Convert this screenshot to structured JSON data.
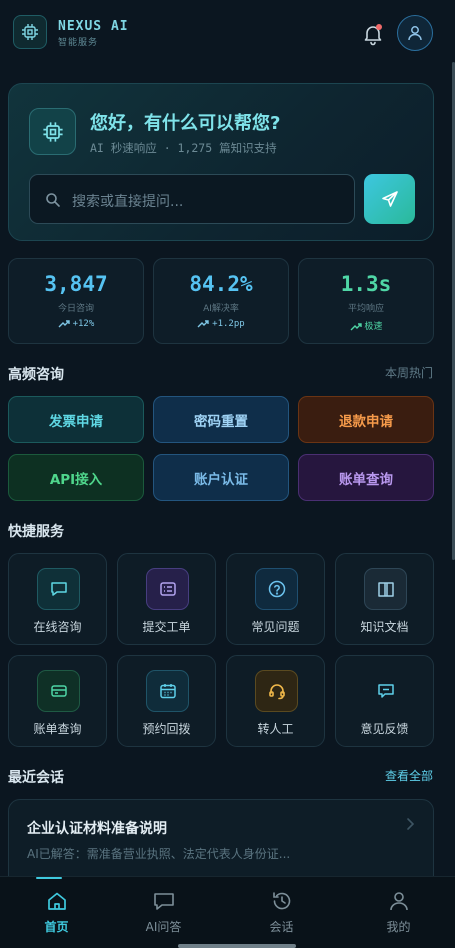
{
  "brand": {
    "name": "NEXUS AI",
    "subtitle": "智能服务"
  },
  "hero": {
    "title": "您好，有什么可以帮您?",
    "subtitle": "AI 秒速响应 · 1,275 篇知识支持",
    "search_placeholder": "搜索或直接提问..."
  },
  "stats": [
    {
      "value": "3,847",
      "label": "今日咨询",
      "trend": "+12%",
      "color": "#56c3f2"
    },
    {
      "value": "84.2%",
      "label": "AI解决率",
      "trend": "+1.2pp",
      "color": "#56c3f2"
    },
    {
      "value": "1.3s",
      "label": "平均响应",
      "trend": "极速",
      "color": "#4fd6a6"
    }
  ],
  "hot": {
    "title": "高频咨询",
    "more": "本周热门",
    "items": [
      "发票申请",
      "密码重置",
      "退款申请",
      "API接入",
      "账户认证",
      "账单查询"
    ]
  },
  "quick": {
    "title": "快捷服务",
    "items": [
      {
        "label": "在线咨询",
        "icon": "chat-bubble-icon"
      },
      {
        "label": "提交工单",
        "icon": "ticket-icon"
      },
      {
        "label": "常见问题",
        "icon": "help-circle-icon"
      },
      {
        "label": "知识文档",
        "icon": "book-icon"
      },
      {
        "label": "账单查询",
        "icon": "credit-card-icon"
      },
      {
        "label": "预约回拨",
        "icon": "calendar-icon"
      },
      {
        "label": "转人工",
        "icon": "headset-icon"
      },
      {
        "label": "意见反馈",
        "icon": "feedback-icon"
      }
    ]
  },
  "recent": {
    "title": "最近会话",
    "more": "查看全部",
    "items": [
      {
        "title": "企业认证材料准备说明",
        "preview": "AI已解答：需准备营业执照、法定代表人身份证..."
      }
    ]
  },
  "nav": [
    {
      "label": "首页",
      "active": true
    },
    {
      "label": "AI问答",
      "active": false
    },
    {
      "label": "会话",
      "active": false
    },
    {
      "label": "我的",
      "active": false
    }
  ],
  "colors": {
    "accent": "#3fc9de",
    "green": "#4fd6a6",
    "background": "#0b1620"
  }
}
